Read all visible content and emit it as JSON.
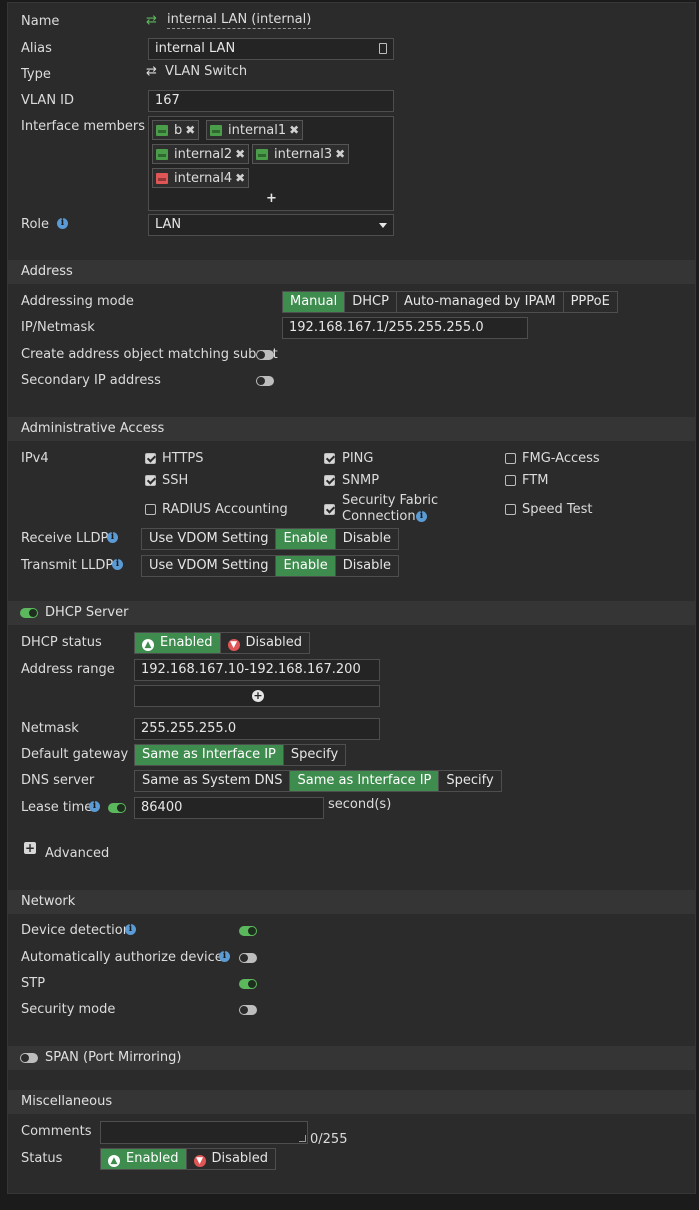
{
  "fields": {
    "name_label": "Name",
    "name_value": "internal LAN (internal)",
    "alias_label": "Alias",
    "alias_value": "internal LAN",
    "type_label": "Type",
    "type_value": "VLAN Switch",
    "vlan_label": "VLAN ID",
    "vlan_value": "167",
    "members_label": "Interface members",
    "members": [
      {
        "name": "b",
        "status": "up"
      },
      {
        "name": "internal1",
        "status": "up"
      },
      {
        "name": "internal2",
        "status": "up"
      },
      {
        "name": "internal3",
        "status": "up"
      },
      {
        "name": "internal4",
        "status": "down"
      }
    ],
    "add_symbol": "+",
    "role_label": "Role",
    "role_value": "LAN"
  },
  "address": {
    "title": "Address",
    "mode_label": "Addressing mode",
    "modes": [
      "Manual",
      "DHCP",
      "Auto-managed by IPAM",
      "PPPoE"
    ],
    "mode_selected": "Manual",
    "ip_label": "IP/Netmask",
    "ip_value": "192.168.167.1/255.255.255.0",
    "create_obj_label": "Create address object matching subnet",
    "create_obj_on": false,
    "secondary_label": "Secondary IP address",
    "secondary_on": false
  },
  "admin": {
    "title": "Administrative Access",
    "ipv4_label": "IPv4",
    "options": [
      {
        "label": "HTTPS",
        "checked": true
      },
      {
        "label": "PING",
        "checked": true
      },
      {
        "label": "FMG-Access",
        "checked": false
      },
      {
        "label": "SSH",
        "checked": true
      },
      {
        "label": "SNMP",
        "checked": true
      },
      {
        "label": "FTM",
        "checked": false
      },
      {
        "label": "RADIUS Accounting",
        "checked": false
      },
      {
        "label": "Security Fabric",
        "label2": "Connection",
        "checked": true
      },
      {
        "label": "Speed Test",
        "checked": false
      }
    ],
    "receive_lldp_label": "Receive LLDP",
    "transmit_lldp_label": "Transmit LLDP",
    "lldp_options": [
      "Use VDOM Setting",
      "Enable",
      "Disable"
    ],
    "lldp_selected": "Enable"
  },
  "dhcp": {
    "title": "DHCP Server",
    "enabled": true,
    "status_label": "DHCP status",
    "status_enabled": "Enabled",
    "status_disabled": "Disabled",
    "range_label": "Address range",
    "range_value": "192.168.167.10-192.168.167.200",
    "netmask_label": "Netmask",
    "netmask_value": "255.255.255.0",
    "gateway_label": "Default gateway",
    "gateway_options": [
      "Same as Interface IP",
      "Specify"
    ],
    "dns_label": "DNS server",
    "dns_options": [
      "Same as System DNS",
      "Same as Interface IP",
      "Specify"
    ],
    "lease_label": "Lease time",
    "lease_value": "86400",
    "lease_unit": "second(s)",
    "advanced_label": "Advanced"
  },
  "network": {
    "title": "Network",
    "device_detection_label": "Device detection",
    "auto_auth_label": "Automatically authorize devices",
    "stp_label": "STP",
    "security_mode_label": "Security mode"
  },
  "span": {
    "title": "SPAN (Port Mirroring)"
  },
  "misc": {
    "title": "Miscellaneous",
    "comments_label": "Comments",
    "comments_count": "0/255",
    "status_label": "Status",
    "status_enabled": "Enabled",
    "status_disabled": "Disabled"
  },
  "colors": {
    "accent": "#3f8c4f",
    "toggle_on": "#5cb85c",
    "info": "#5b9bd5",
    "link_down": "#e05555"
  }
}
